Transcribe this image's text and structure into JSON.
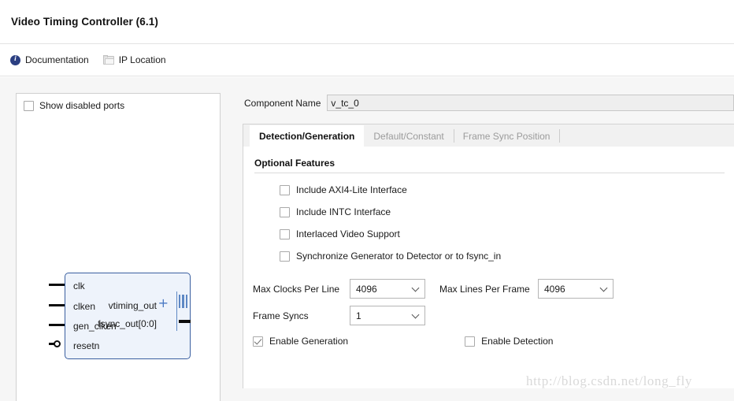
{
  "window": {
    "title": "Video Timing Controller (6.1)"
  },
  "toolbar": {
    "documentation_label": "Documentation",
    "documentation_icon": "info-circle-icon",
    "ip_location_label": "IP Location",
    "ip_location_icon": "folder-icon"
  },
  "left_panel": {
    "show_disabled_ports_label": "Show disabled ports",
    "show_disabled_ports_checked": false,
    "symbol": {
      "input_ports": [
        {
          "name": "clk",
          "inverted": false
        },
        {
          "name": "clken",
          "inverted": false
        },
        {
          "name": "gen_clken",
          "inverted": false
        },
        {
          "name": "resetn",
          "inverted": true
        }
      ],
      "output_ports": [
        {
          "name": "vtiming_out",
          "type": "bus",
          "expand_icon": "plus-icon"
        },
        {
          "name": "fsync_out[0:0]",
          "type": "pin"
        }
      ],
      "fill_color": "#eef3fb",
      "border_color": "#3a5fa0",
      "bus_color": "#5e88c4"
    }
  },
  "right_panel": {
    "component_name_label": "Component Name",
    "component_name_value": "v_tc_0",
    "tabs": [
      {
        "label": "Detection/Generation",
        "active": true,
        "disabled": false
      },
      {
        "label": "Default/Constant",
        "active": false,
        "disabled": true
      },
      {
        "label": "Frame Sync Position",
        "active": false,
        "disabled": true
      }
    ],
    "optional_features": {
      "section_title": "Optional Features",
      "items": [
        {
          "label": "Include AXI4-Lite Interface",
          "checked": false
        },
        {
          "label": "Include INTC Interface",
          "checked": false
        },
        {
          "label": "Interlaced Video Support",
          "checked": false
        },
        {
          "label": "Synchronize Generator to Detector or to fsync_in",
          "checked": false
        }
      ]
    },
    "fields": {
      "max_clocks_per_line_label": "Max Clocks Per Line",
      "max_clocks_per_line_value": "4096",
      "max_lines_per_frame_label": "Max Lines Per Frame",
      "max_lines_per_frame_value": "4096",
      "frame_syncs_label": "Frame Syncs",
      "frame_syncs_value": "1"
    },
    "enables": {
      "enable_generation_label": "Enable Generation",
      "enable_generation_checked": true,
      "enable_detection_label": "Enable Detection",
      "enable_detection_checked": false
    }
  },
  "watermark": {
    "text": "http://blog.csdn.net/long_fly"
  }
}
